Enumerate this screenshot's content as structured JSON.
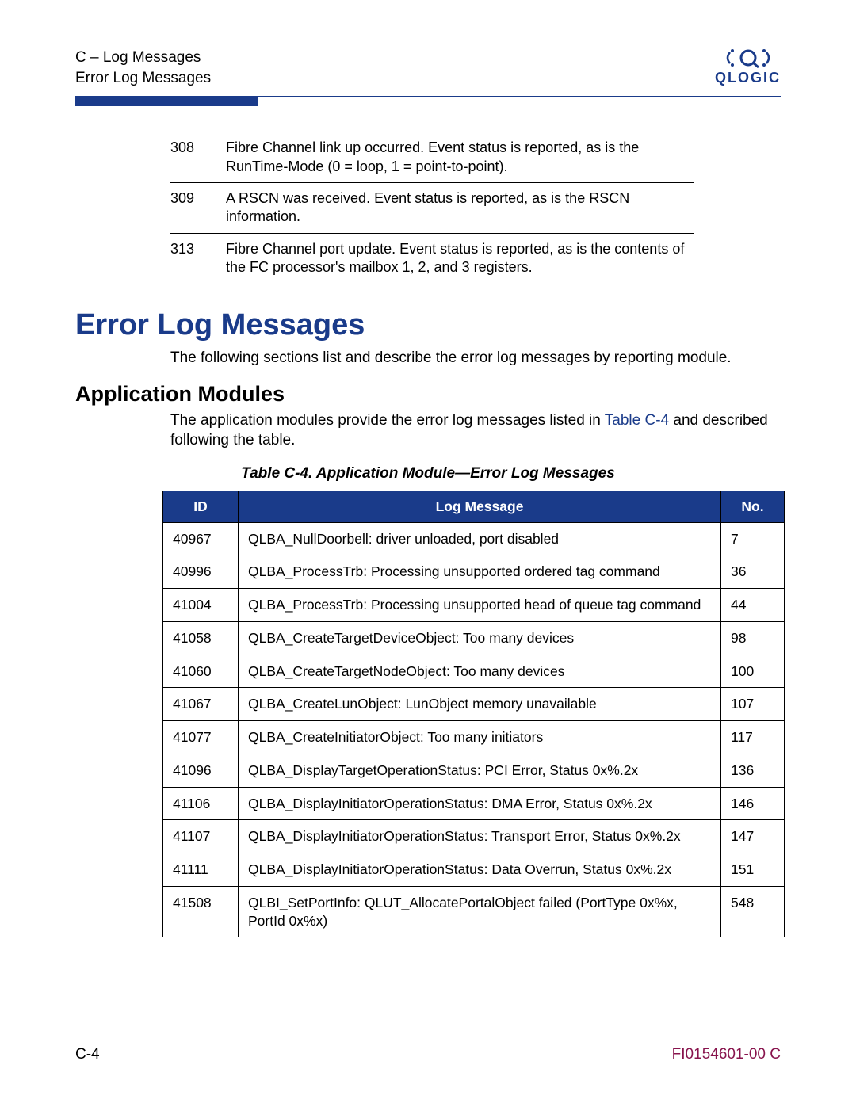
{
  "header": {
    "line1": "C – Log Messages",
    "line2": "Error Log Messages",
    "brand": "QLOGIC"
  },
  "top_rows": [
    {
      "id": "308",
      "text": "Fibre Channel link up occurred. Event status is reported, as is the RunTime-Mode (0 = loop, 1 = point-to-point)."
    },
    {
      "id": "309",
      "text": "A RSCN was received. Event status is reported, as is the RSCN information."
    },
    {
      "id": "313",
      "text": "Fibre Channel port update. Event status is reported, as is the contents of the FC processor's mailbox 1, 2, and 3 registers."
    }
  ],
  "section_title": "Error Log Messages",
  "section_body": "The following sections list and describe the error log messages by reporting module.",
  "subsection_title": "Application Modules",
  "subsection_body_pre": "The application modules provide the error log messages listed in ",
  "subsection_body_link": "Table C-4",
  "subsection_body_post": " and described following the table.",
  "table_caption": "Table C-4. Application Module—Error Log Messages",
  "table_headers": {
    "id": "ID",
    "msg": "Log Message",
    "no": "No."
  },
  "rows": [
    {
      "id": "40967",
      "msg": "QLBA_NullDoorbell: driver unloaded, port disabled",
      "no": "7"
    },
    {
      "id": "40996",
      "msg": "QLBA_ProcessTrb: Processing unsupported ordered tag command",
      "no": "36"
    },
    {
      "id": "41004",
      "msg": "QLBA_ProcessTrb: Processing unsupported head of queue tag command",
      "no": "44"
    },
    {
      "id": "41058",
      "msg": "QLBA_CreateTargetDeviceObject: Too many devices",
      "no": "98"
    },
    {
      "id": "41060",
      "msg": "QLBA_CreateTargetNodeObject: Too many devices",
      "no": "100"
    },
    {
      "id": "41067",
      "msg": "QLBA_CreateLunObject: LunObject memory unavailable",
      "no": "107"
    },
    {
      "id": "41077",
      "msg": "QLBA_CreateInitiatorObject: Too many initiators",
      "no": "117"
    },
    {
      "id": "41096",
      "msg": "QLBA_DisplayTargetOperationStatus: PCI Error, Status 0x%.2x",
      "no": "136"
    },
    {
      "id": "41106",
      "msg": "QLBA_DisplayInitiatorOperationStatus: DMA Error, Status 0x%.2x",
      "no": "146"
    },
    {
      "id": "41107",
      "msg": "QLBA_DisplayInitiatorOperationStatus: Transport Error, Status 0x%.2x",
      "no": "147"
    },
    {
      "id": "41111",
      "msg": "QLBA_DisplayInitiatorOperationStatus: Data Overrun, Status 0x%.2x",
      "no": "151"
    },
    {
      "id": "41508",
      "msg": "QLBI_SetPortInfo: QLUT_AllocatePortalObject failed (PortType 0x%x, PortId 0x%x)",
      "no": "548"
    }
  ],
  "footer": {
    "left": "C-4",
    "right": "FI0154601-00  C"
  }
}
